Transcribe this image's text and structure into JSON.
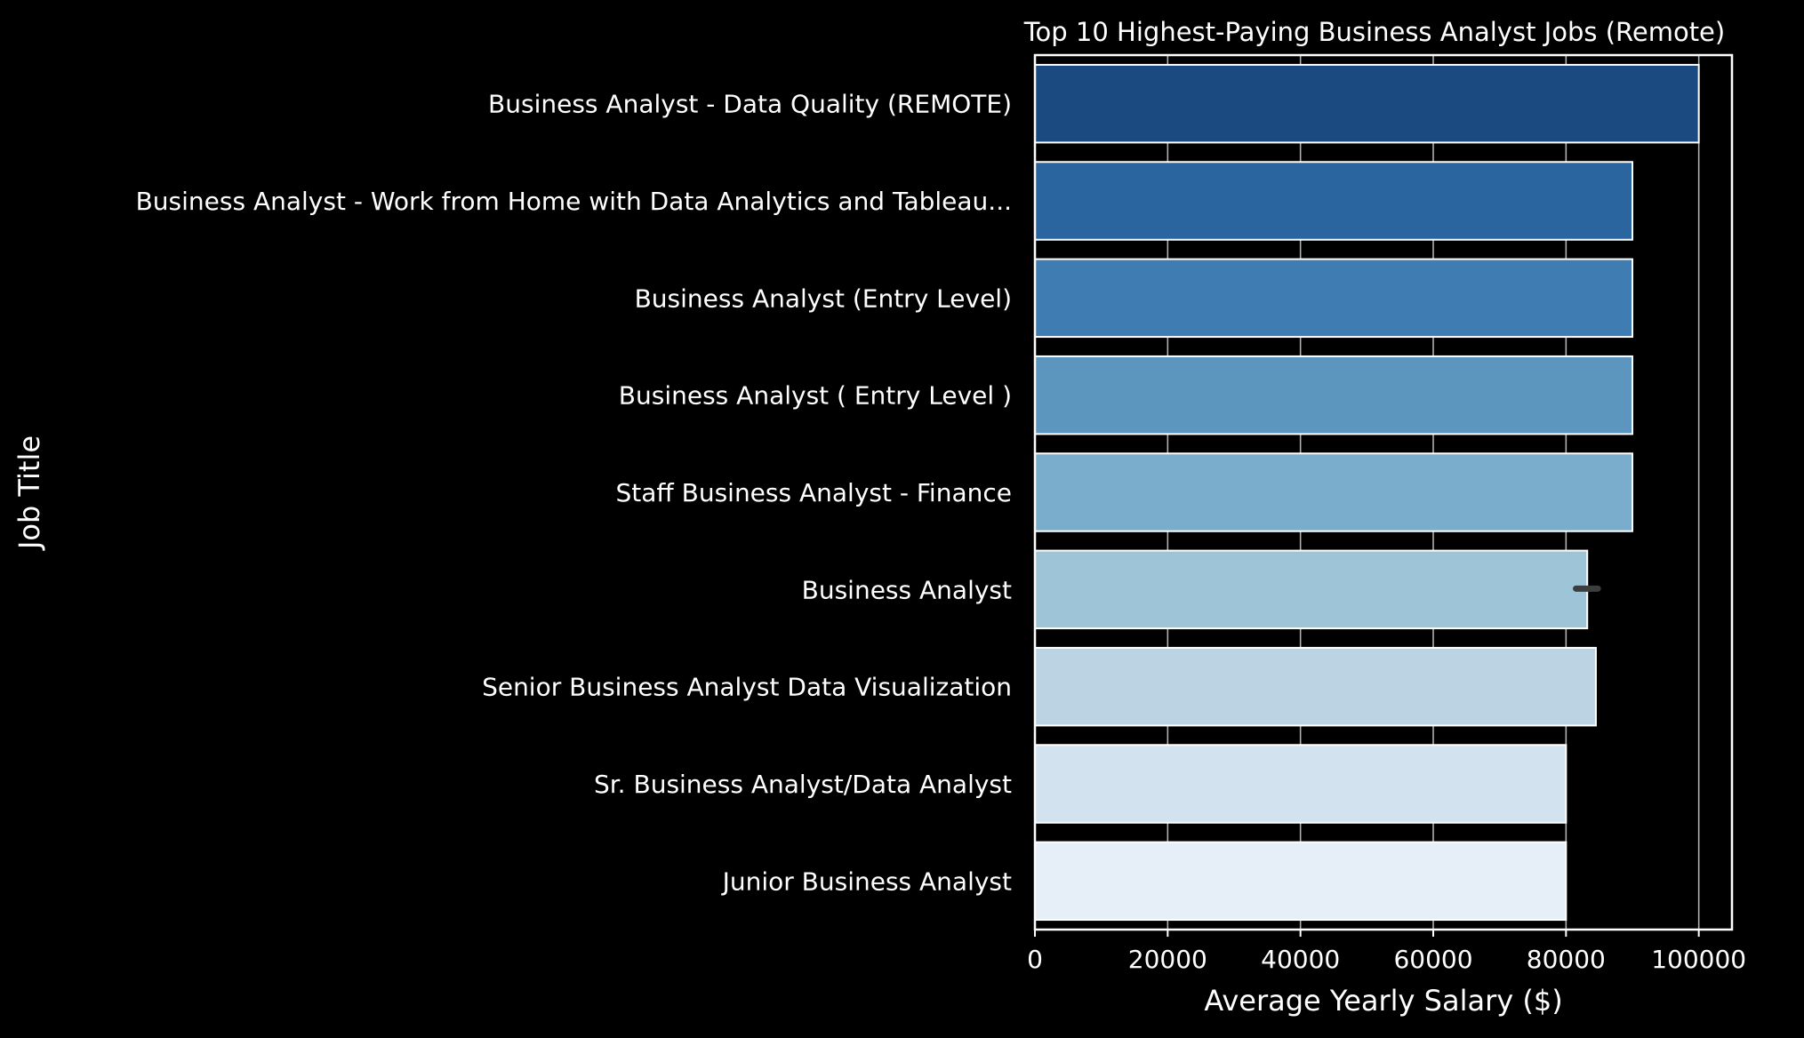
{
  "chart_data": {
    "type": "bar",
    "orientation": "horizontal",
    "title": "Top 10 Highest-Paying Business Analyst Jobs (Remote)",
    "xlabel": "Average Yearly Salary ($)",
    "ylabel": "Job Title",
    "xlim": [
      0,
      105000
    ],
    "xticks": [
      0,
      20000,
      40000,
      60000,
      80000,
      100000
    ],
    "grid": true,
    "categories": [
      "Business Analyst - Data Quality (REMOTE)",
      "Business Analyst - Work from Home with Data Analytics and Tableau...",
      "Business Analyst (Entry Level)",
      "Business Analyst ( Entry Level )",
      "Staff Business Analyst - Finance",
      "Business Analyst",
      "Senior  Business Analyst  Data Visualization",
      "Sr. Business Analyst/Data Analyst",
      "Junior Business Analyst"
    ],
    "values": [
      100000,
      90000,
      90000,
      90000,
      90000,
      83200,
      84500,
      80000,
      80000
    ],
    "error_bars": [
      null,
      null,
      null,
      null,
      null,
      [
        81500,
        84800
      ],
      null,
      null,
      null
    ],
    "colors": [
      "#1a4a7f",
      "#2b65a0",
      "#3e7cb1",
      "#5c95bd",
      "#7aaccb",
      "#9ec4d7",
      "#bcd3e4",
      "#d3e2ef",
      "#e6eef7"
    ]
  }
}
